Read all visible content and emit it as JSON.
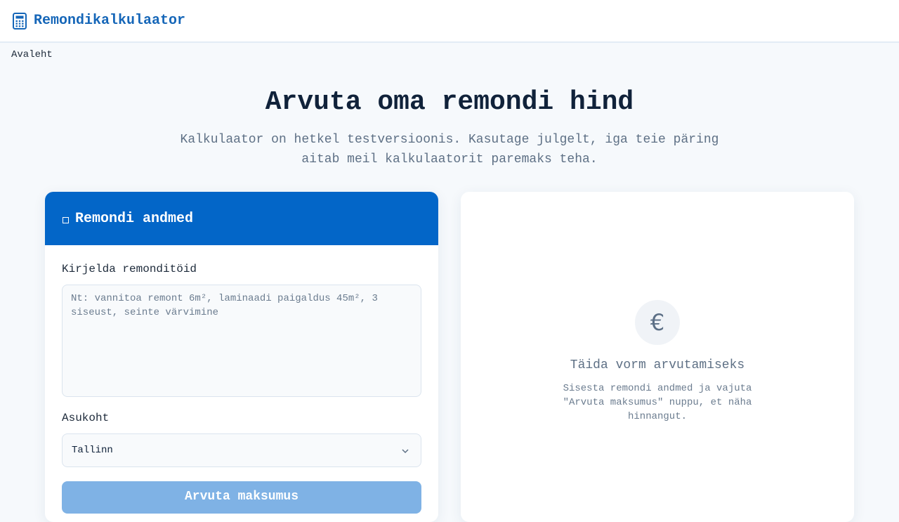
{
  "header": {
    "brand_name": "Remondikalkulaator",
    "brand_icon": "calculator-icon",
    "accent_color": "#1566b8"
  },
  "breadcrumb": {
    "home": "Avaleht"
  },
  "hero": {
    "title": "Arvuta oma remondi hind",
    "subtitle": "Kalkulaator on hetkel testversioonis. Kasutage julgelt, iga teie päring aitab meil kalkulaatorit paremaks teha."
  },
  "form": {
    "header_title": "Remondi andmed",
    "header_icon": "square-icon",
    "header_color": "#0366c8",
    "description_label": "Kirjelda remonditöid",
    "description_placeholder": "Nt: vannitoa remont 6m², laminaadi paigaldus 45m², 3 siseust, seinte värvimine",
    "description_value": "",
    "location_label": "Asukoht",
    "location_value": "Tallinn",
    "submit_label": "Arvuta maksumus",
    "submit_color": "#7fb2e5"
  },
  "result": {
    "icon": "euro-icon",
    "empty_title": "Täida vorm arvutamiseks",
    "empty_text": "Sisesta remondi andmed ja vajuta \"Arvuta maksumus\" nuppu, et näha hinnangut."
  }
}
